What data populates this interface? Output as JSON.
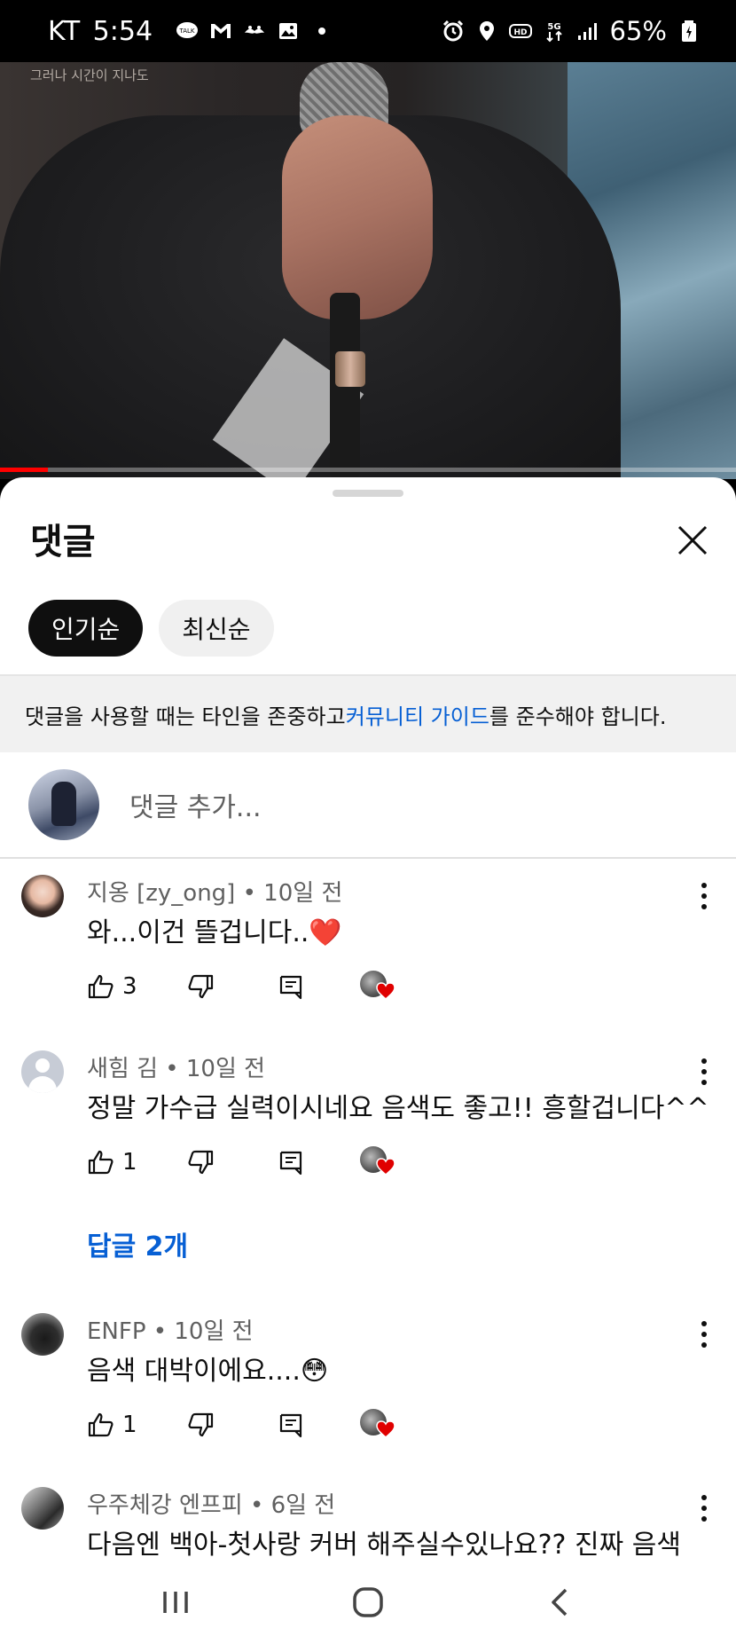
{
  "status_bar": {
    "carrier": "KT",
    "time": "5:54",
    "battery": "65%",
    "left_icons": [
      "talk-icon",
      "gmail-icon",
      "mustache-icon",
      "image-icon",
      "dot-icon"
    ],
    "right_icons": [
      "alarm-icon",
      "location-icon",
      "hd-icon",
      "5g-icon",
      "signal-icon",
      "battery-icon"
    ]
  },
  "video": {
    "caption": "그러나 시간이 지나도",
    "progress_fraction": 0.065
  },
  "sheet": {
    "title": "댓글",
    "chips": [
      {
        "label": "인기순",
        "active": true
      },
      {
        "label": "최신순",
        "active": false
      }
    ],
    "guideline": {
      "before": "댓글을 사용할 때는 타인을 존중하고 ",
      "link": "커뮤니티 가이드",
      "after": "를 준수해야 합니다."
    },
    "add_comment_placeholder": "댓글 추가..."
  },
  "comments": [
    {
      "author": "지옹 [zy_ong]",
      "age": "10일 전",
      "meta": "지옹 [zy_ong] • 10일 전",
      "text": "와...이건 뜰겁니다..❤️",
      "likes": "3",
      "creator_heart": true
    },
    {
      "author": "새힘 김",
      "age": "10일 전",
      "meta": "새힘 김 • 10일 전",
      "text": "정말 가수급 실력이시네요 음색도 좋고!! 흥할겁니다^^",
      "likes": "1",
      "creator_heart": true,
      "replies_label": "답글 2개"
    },
    {
      "author": "ENFP",
      "age": "10일 전",
      "meta": "ENFP • 10일 전",
      "text": "음색 대박이에요....😳",
      "likes": "1",
      "creator_heart": true
    },
    {
      "author": "우주체강 엔프피",
      "age": "6일 전",
      "meta": "우주체강 엔프피 • 6일 전",
      "text": "다음엔 백아-첫사랑 커버 해주실수있나요?? 진짜 음색"
    }
  ],
  "nav_bar": {
    "buttons": [
      "recent-apps-icon",
      "home-icon",
      "back-icon"
    ]
  },
  "colors": {
    "link_blue": "#065fd4",
    "progress_red": "#ff0000",
    "heart_red": "#e00000",
    "chip_active": "#0f0f0f"
  }
}
